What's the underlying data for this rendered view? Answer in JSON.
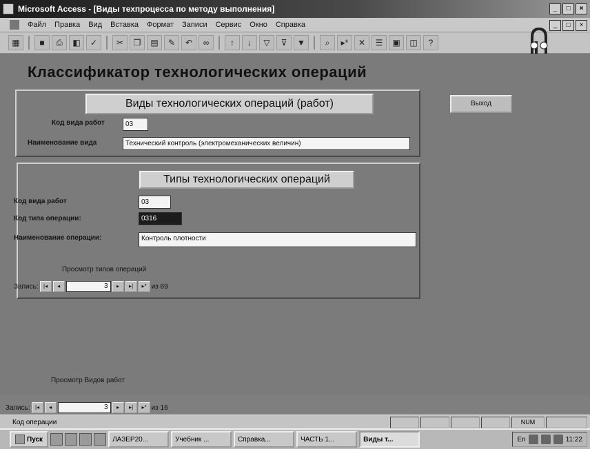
{
  "window": {
    "title": "Microsoft Access - [Виды техпроцесса по методу выполнения]"
  },
  "menu": [
    "Файл",
    "Правка",
    "Вид",
    "Вставка",
    "Формат",
    "Записи",
    "Сервис",
    "Окно",
    "Справка"
  ],
  "toolbar": {
    "icons": [
      "view-icon",
      "save-icon",
      "print-icon",
      "preview-icon",
      "spell-icon",
      "cut-icon",
      "copy-icon",
      "paste-icon",
      "format-painter-icon",
      "undo-icon",
      "hyperlink-icon",
      "sort-asc-icon",
      "sort-desc-icon",
      "filter-selection-icon",
      "filter-form-icon",
      "apply-filter-icon",
      "find-icon",
      "new-record-icon",
      "delete-record-icon",
      "properties-icon",
      "database-window-icon",
      "new-object-icon",
      "help-icon"
    ]
  },
  "form": {
    "title": "Классификатор технологических операций",
    "exit_label": "Выход",
    "types_of_work": {
      "header": "Виды технологических операций (работ)",
      "code_label": "Код вида работ",
      "code_value": "03",
      "name_label": "Наименование вида",
      "name_value": "Технический контроль (электромеханических величин)"
    },
    "operations": {
      "header": "Типы технологических операций",
      "code_work_label": "Код вида работ",
      "code_work_value": "03",
      "code_op_label": "Код типа операции:",
      "code_op_value": "0316",
      "name_op_label": "Наименование операции:",
      "name_op_value": "Контроль плотности",
      "caption": "Просмотр типов операций",
      "nav_label": "Запись:",
      "nav_value": "3",
      "nav_total": "из 69"
    },
    "works_caption": "Просмотр Видов работ",
    "outer_nav_label": "Запись:",
    "outer_nav_value": "3",
    "outer_nav_total": "из 16"
  },
  "status": {
    "text": "Код операции",
    "num": "NUM"
  },
  "taskbar": {
    "start": "Пуск",
    "tasks": [
      "ЛАЗЕР20...",
      "Учебник ...",
      "Справка...",
      "ЧАСТЬ 1...",
      "Виды т..."
    ],
    "clock": "11:22",
    "lang": "En"
  }
}
